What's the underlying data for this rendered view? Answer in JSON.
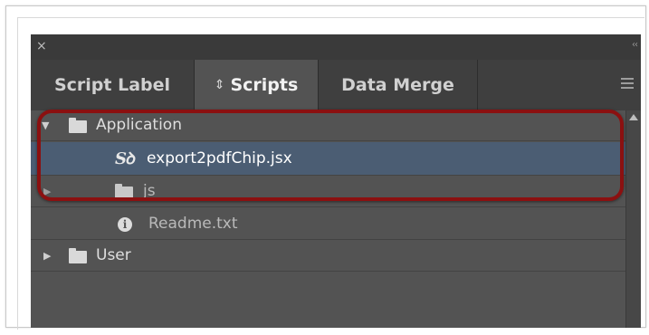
{
  "window": {
    "close_glyph": "×",
    "collapse_glyph": "‹‹",
    "menu_icon": "panel-menu-icon"
  },
  "tabs": [
    {
      "label": "Script Label",
      "active": false
    },
    {
      "label": "Scripts",
      "active": true,
      "prefix_glyph": "⇕"
    },
    {
      "label": "Data Merge",
      "active": false
    }
  ],
  "tree": {
    "items": [
      {
        "label": "Application",
        "type": "folder",
        "expanded": true
      },
      {
        "label": "export2pdfChip.jsx",
        "type": "script",
        "selected": true,
        "icon_text": "Sꝺ"
      },
      {
        "label": "js",
        "type": "folder",
        "expanded": false
      },
      {
        "label": "Readme.txt",
        "type": "info-file",
        "icon_text": "i"
      },
      {
        "label": "User",
        "type": "folder",
        "expanded": false
      }
    ]
  },
  "colors": {
    "panel_bg": "#535353",
    "selection": "#4b5d73",
    "highlight_ring": "#8b1010"
  }
}
